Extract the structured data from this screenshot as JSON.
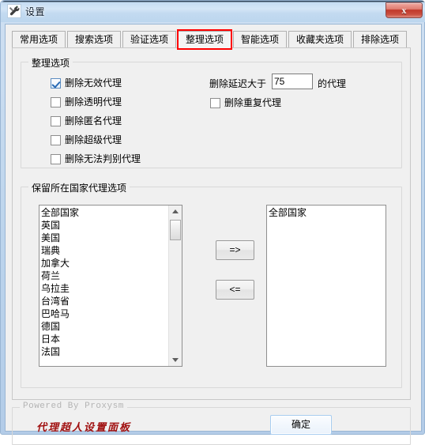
{
  "window": {
    "title": "设置",
    "icon": "wrench-tool-icon",
    "close_label": "x",
    "accent_red": "#ff0000",
    "brand_red": "#a01010"
  },
  "tabs": [
    {
      "label": "常用选项",
      "active": false
    },
    {
      "label": "搜索选项",
      "active": false
    },
    {
      "label": "验证选项",
      "active": false
    },
    {
      "label": "整理选项",
      "active": true
    },
    {
      "label": "智能选项",
      "active": false
    },
    {
      "label": "收藏夹选项",
      "active": false
    },
    {
      "label": "排除选项",
      "active": false
    }
  ],
  "cleanup_group": {
    "title": "整理选项",
    "left_checkboxes": [
      {
        "label": "删除无效代理",
        "checked": true
      },
      {
        "label": "删除透明代理",
        "checked": false
      },
      {
        "label": "删除匿名代理",
        "checked": false
      },
      {
        "label": "删除超级代理",
        "checked": false
      },
      {
        "label": "删除无法判别代理",
        "checked": false
      }
    ],
    "delay_prefix": "删除延迟大于",
    "delay_value": "75",
    "delay_suffix": "的代理",
    "duplicate_checkbox": {
      "label": "删除重复代理",
      "checked": false
    }
  },
  "country_group": {
    "title": "保留所在国家代理选项",
    "available": [
      "全部国家",
      "英国",
      "美国",
      "瑞典",
      "加拿大",
      "荷兰",
      "乌拉圭",
      "台湾省",
      "巴哈马",
      "德国",
      "日本",
      "法国"
    ],
    "selected": [
      "全部国家"
    ],
    "add_button": "=>",
    "remove_button": "<="
  },
  "footer": {
    "powered_by": "Powered By Proxysm",
    "brand": "代理超人设置面板",
    "ok_button": "确定"
  }
}
